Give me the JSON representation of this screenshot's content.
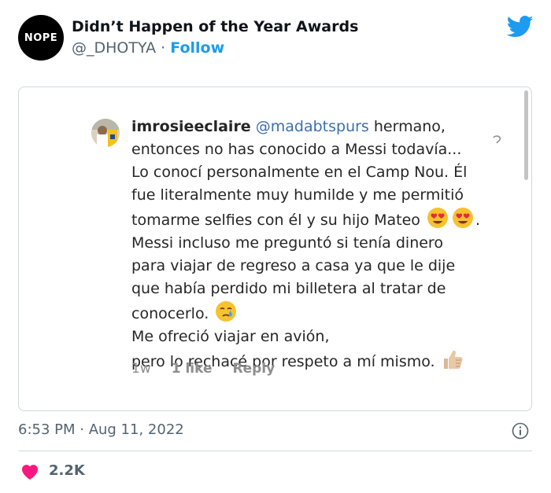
{
  "author": {
    "avatar_text": "NOPE",
    "display_name": "Didn’t Happen of the Year Awards",
    "handle": "@_DHOTYA",
    "separator": " · ",
    "follow_label": "Follow"
  },
  "embedded_comment": {
    "username": "imrosieeclaire",
    "mention": "@madabtspurs",
    "lines": [
      " hermano,",
      "entonces no has conocido a Messi todavía...",
      "Lo conocí personalmente en el Camp Nou. Él",
      "fue literalmente muy humilde y me permitió",
      "tomarme selfies con él y su hijo Mateo",
      ".",
      "Messi incluso me preguntó si tenía dinero",
      "para viajar de regreso a casa ya que le dije",
      "que había perdido mi billetera al tratar de",
      "conocerlo.",
      " Me ofreció viajar en avión,",
      "pero lo rechacé por respeto a mí mismo."
    ],
    "time_ago": "1w",
    "likes_label": "1 like",
    "reply_label": "Reply"
  },
  "footer": {
    "timestamp": "6:53 PM · Aug 11, 2022",
    "like_count": "2.2K"
  },
  "colors": {
    "twitter_blue": "#1d9bf0",
    "like_red": "#f91880"
  }
}
